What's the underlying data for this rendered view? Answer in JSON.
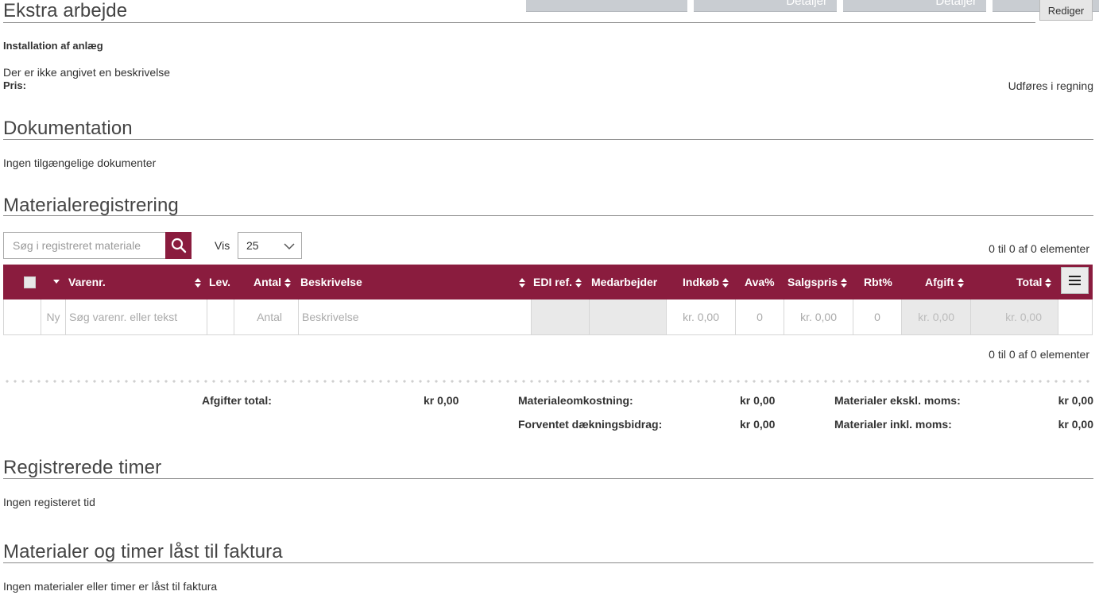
{
  "top_tabs": {
    "tab2": "Detaljer",
    "tab3": "Detaljer",
    "edit_button": "Rediger"
  },
  "extra_work": {
    "title": "Ekstra arbejde",
    "item_title": "Installation af anlæg",
    "description": "Der er ikke angivet en beskrivelse",
    "price_label": "Pris:",
    "price_value": "Udføres i regning"
  },
  "documentation": {
    "title": "Dokumentation",
    "empty": "Ingen tilgængelige dokumenter"
  },
  "materials": {
    "title": "Materialeregistrering",
    "search_placeholder": "Søg i registreret materiale",
    "vis_label": "Vis",
    "page_size": "25",
    "count_text": "0 til 0 af 0 elementer",
    "columns": {
      "varenr": "Varenr.",
      "lev": "Lev.",
      "antal": "Antal",
      "beskrivelse": "Beskrivelse",
      "edi": "EDI ref.",
      "medarbejder": "Medarbejder",
      "indkob": "Indkøb",
      "ava": "Ava%",
      "salgspris": "Salgspris",
      "rbt": "Rbt%",
      "afgift": "Afgift",
      "total": "Total"
    },
    "new_row": {
      "ny": "Ny",
      "varenr_placeholder": "Søg varenr. eller tekst",
      "antal_placeholder": "Antal",
      "beskrivelse_placeholder": "Beskrivelse",
      "indkob": "kr. 0,00",
      "ava": "0",
      "salgspris": "kr. 0,00",
      "rbt": "0",
      "afgift": "kr. 0,00",
      "total": "kr. 0,00"
    },
    "summary": {
      "afgifter_label": "Afgifter total:",
      "afgifter_value": "kr 0,00",
      "materialeomk_label": "Materialeomkostning:",
      "materialeomk_value": "kr 0,00",
      "daekning_label": "Forventet dækningsbidrag:",
      "daekning_value": "kr 0,00",
      "ekskl_label": "Materialer ekskl. moms:",
      "ekskl_value": "kr 0,00",
      "inkl_label": "Materialer inkl. moms:",
      "inkl_value": "kr 0,00"
    }
  },
  "hours": {
    "title": "Registrerede timer",
    "empty": "Ingen registeret tid"
  },
  "locked": {
    "title": "Materialer og timer låst til faktura",
    "empty": "Ingen materialer eller timer er låst til faktura"
  },
  "colors": {
    "brand": "#8a1c3e"
  },
  "icons": {
    "search": "search-icon",
    "menu": "hamburger-menu-icon",
    "dropdown": "chevron-down-icon"
  }
}
